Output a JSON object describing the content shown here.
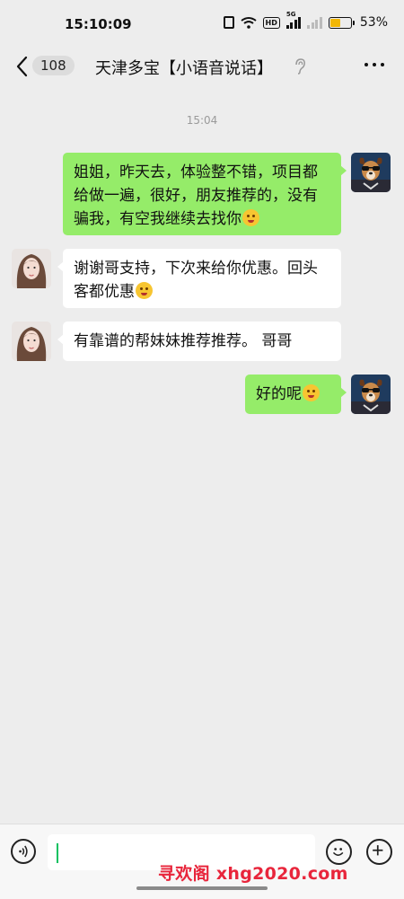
{
  "status_bar": {
    "time": "15:10:09",
    "network_label": "5G",
    "hd_label": "HD",
    "battery_percent": "53%",
    "battery_level": 0.53,
    "battery_color": "#f2b705"
  },
  "nav": {
    "back_icon": "chevron-left-icon",
    "unread_count": "108",
    "title": "天津多宝【小语音说话】",
    "title_icon": "ear-icon",
    "more_icon": "more-horizontal-icon"
  },
  "chat": {
    "timestamp": "15:04",
    "messages": [
      {
        "sender": "me",
        "text": "姐姐，昨天去，体验整不错，项目都给做一遍，很好，朋友推荐的，没有骗我，有空我继续去找你",
        "emoji": "thinking-face"
      },
      {
        "sender": "them",
        "text": "谢谢哥支持，下次来给你优惠。回头客都优惠",
        "emoji": "winking-tongue-face"
      },
      {
        "sender": "them",
        "text": "有靠谱的帮妹妹推荐推荐。 哥哥",
        "emoji": ""
      },
      {
        "sender": "me",
        "text": "好的呢",
        "emoji": "hot-face"
      }
    ]
  },
  "input_bar": {
    "voice_icon": "voice-icon",
    "emoji_icon": "smiley-icon",
    "plus_icon": "plus-icon",
    "value": ""
  },
  "watermark": "寻欢阁 xhg2020.com",
  "colors": {
    "background": "#ededed",
    "my_bubble": "#95ec69",
    "their_bubble": "#ffffff",
    "watermark": "#e8253b"
  }
}
